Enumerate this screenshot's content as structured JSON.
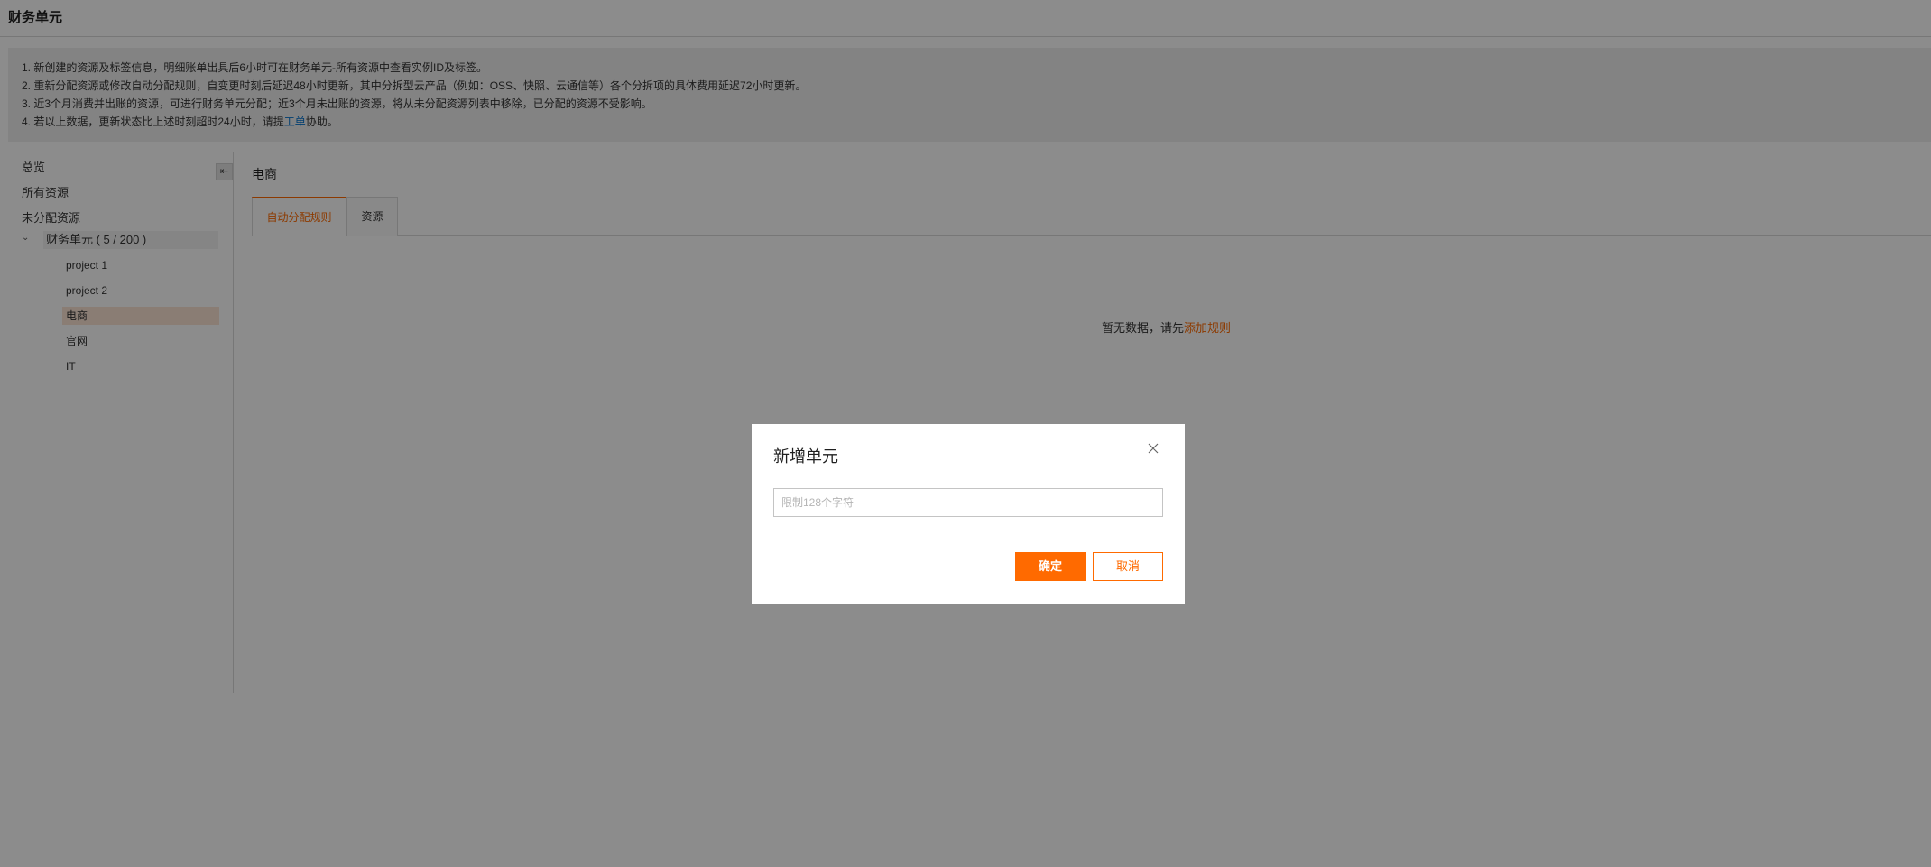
{
  "page": {
    "title": "财务单元"
  },
  "notice": {
    "line1": "1. 新创建的资源及标签信息，明细账单出具后6小时可在财务单元-所有资源中查看实例ID及标签。",
    "line2": "2. 重新分配资源或修改自动分配规则，自变更时刻后延迟48小时更新，其中分拆型云产品（例如：OSS、快照、云通信等）各个分拆项的具体费用延迟72小时更新。",
    "line3": "3. 近3个月消费并出账的资源，可进行财务单元分配；近3个月未出账的资源，将从未分配资源列表中移除，已分配的资源不受影响。",
    "line4_prefix": "4. 若以上数据，更新状态比上述时刻超时24小时，请提",
    "line4_link": "工单",
    "line4_suffix": "协助。"
  },
  "sidebar": {
    "collapse_icon": "arrow-left-icon",
    "collapse_glyph": "⇤",
    "overview": "总览",
    "all_resources": "所有资源",
    "unassigned": "未分配资源",
    "chevron_glyph": "⌄",
    "group_label": "财务单元 ( 5 / 200 )",
    "units": [
      "project 1",
      "project 2",
      "电商",
      "官网",
      "IT"
    ],
    "active_unit": "电商"
  },
  "main": {
    "title": "电商",
    "tabs": [
      "自动分配规则",
      "资源"
    ],
    "active_tab": "自动分配规则",
    "empty_prefix": "暂无数据，请先",
    "empty_link": "添加规则"
  },
  "modal": {
    "title": "新增单元",
    "close_icon": "close-icon",
    "input_placeholder": "限制128个字符",
    "input_value": "",
    "confirm": "确定",
    "cancel": "取消"
  },
  "colors": {
    "accent": "#ff6a00",
    "link_blue": "#0070cc",
    "overlay": "rgba(0,0,0,0.45)"
  }
}
